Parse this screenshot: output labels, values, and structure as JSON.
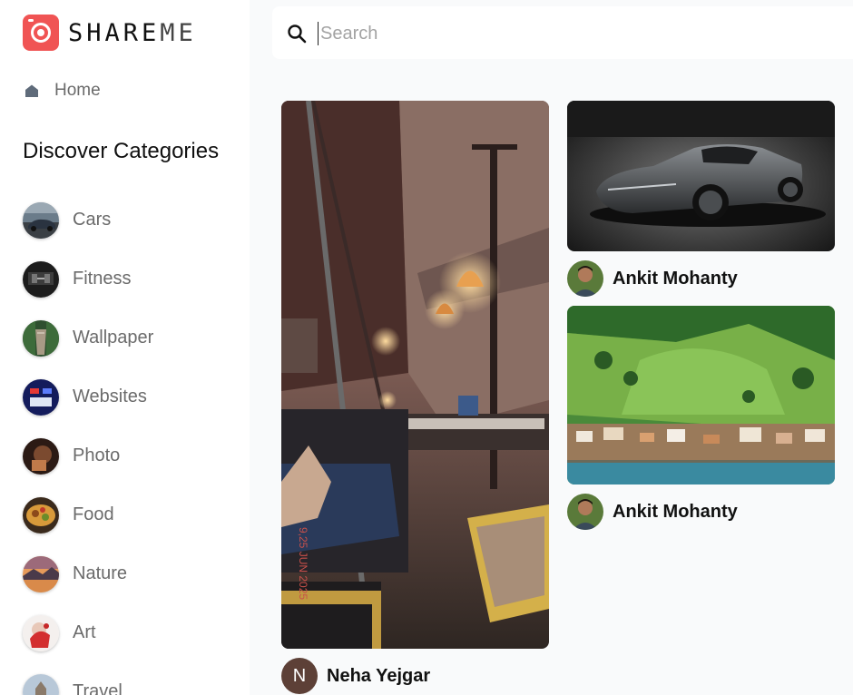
{
  "brand": {
    "name_bold": "SHARE",
    "name_light": "ME",
    "accent": "#f05454"
  },
  "nav": {
    "home_label": "Home"
  },
  "sidebar": {
    "heading": "Discover Categories",
    "categories": [
      {
        "label": "Cars",
        "icon": "cars-thumbnail"
      },
      {
        "label": "Fitness",
        "icon": "fitness-thumbnail"
      },
      {
        "label": "Wallpaper",
        "icon": "wallpaper-thumbnail"
      },
      {
        "label": "Websites",
        "icon": "websites-thumbnail"
      },
      {
        "label": "Photo",
        "icon": "photo-thumbnail"
      },
      {
        "label": "Food",
        "icon": "food-thumbnail"
      },
      {
        "label": "Nature",
        "icon": "nature-thumbnail"
      },
      {
        "label": "Art",
        "icon": "art-thumbnail"
      },
      {
        "label": "Travel",
        "icon": "travel-thumbnail"
      }
    ]
  },
  "search": {
    "placeholder": "Search",
    "value": ""
  },
  "pins": [
    {
      "image": "restaurant-interior-photo",
      "author": "Neha Yejgar",
      "avatar_letter": "N"
    },
    {
      "image": "sports-car-photo",
      "author": "Ankit Mohanty"
    },
    {
      "image": "hillside-village-lake-photo",
      "author": "Ankit Mohanty"
    }
  ]
}
